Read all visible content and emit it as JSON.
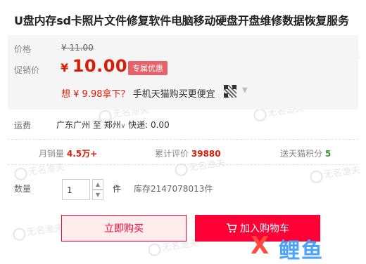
{
  "product": {
    "title": "U盘内存sd卡照片文件修复软件电脑移动硬盘开盘维修数据恢复服务"
  },
  "price": {
    "label_original": "价格",
    "original": "¥ 11.00",
    "label_promo": "促销价",
    "currency": "¥",
    "current": "10.00",
    "tag": "专属优惠"
  },
  "promo": {
    "text": "想 ¥ 9.98拿下？",
    "link": "手机天猫购买更便宜"
  },
  "shipping": {
    "label": "运费",
    "from": "广东广州",
    "to_word": "至",
    "to": "郑州",
    "express": "快递: 0.00"
  },
  "stats": {
    "monthly_label": "月销量",
    "monthly_value": "4.5万+",
    "reviews_label": "累计评价",
    "reviews_value": "39880",
    "points_label": "送天猫积分",
    "points_value": "5"
  },
  "quantity": {
    "label": "数量",
    "value": "1",
    "unit": "件",
    "stock": "库存2147078013件"
  },
  "buttons": {
    "buy_now": "立即购买",
    "add_to_cart": "加入购物车"
  },
  "watermark": {
    "text": "无名渔夫",
    "logo_mark": "X",
    "logo_text": "鲤鱼"
  },
  "colors": {
    "price_red": "#d81e06",
    "tmall_red": "#ff0036",
    "tag_bg": "#e5626a",
    "points_green": "#2e9b2e"
  },
  "icons": [
    "qr-code-icon",
    "chevron-down-icon",
    "cart-icon",
    "stepper-up-icon",
    "stepper-down-icon"
  ]
}
